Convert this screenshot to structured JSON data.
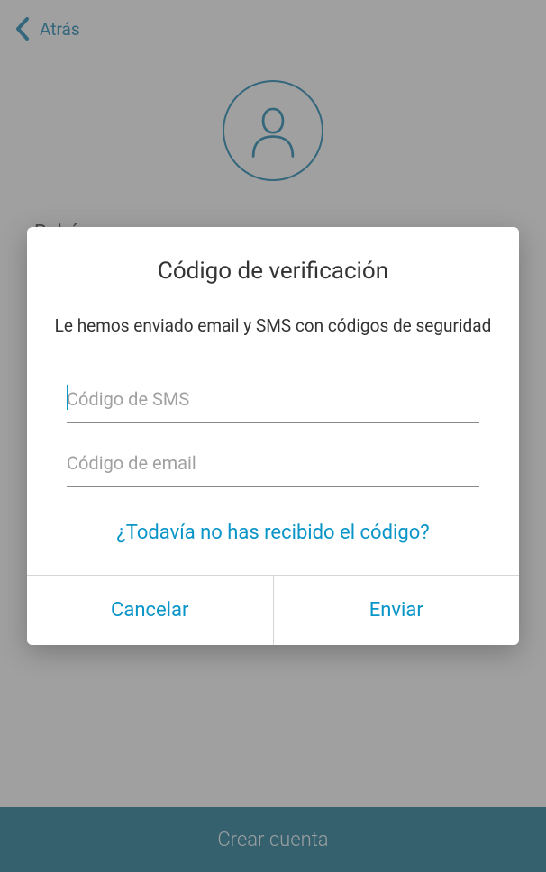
{
  "header": {
    "back_label": "Atrás"
  },
  "profile": {
    "name": "Rubén"
  },
  "footer": {
    "create_account_label": "Crear cuenta"
  },
  "dialog": {
    "title": "Código de verificación",
    "description": "Le hemos enviado email y SMS con códigos de seguridad",
    "sms_placeholder": "Código de SMS",
    "email_placeholder": "Código de email",
    "resend_label": "¿Todavía no has recibido el código?",
    "cancel_label": "Cancelar",
    "send_label": "Enviar"
  },
  "colors": {
    "accent": "#0a95c8",
    "header_accent": "#0878a6",
    "footer_bg": "#0a6a8a"
  }
}
